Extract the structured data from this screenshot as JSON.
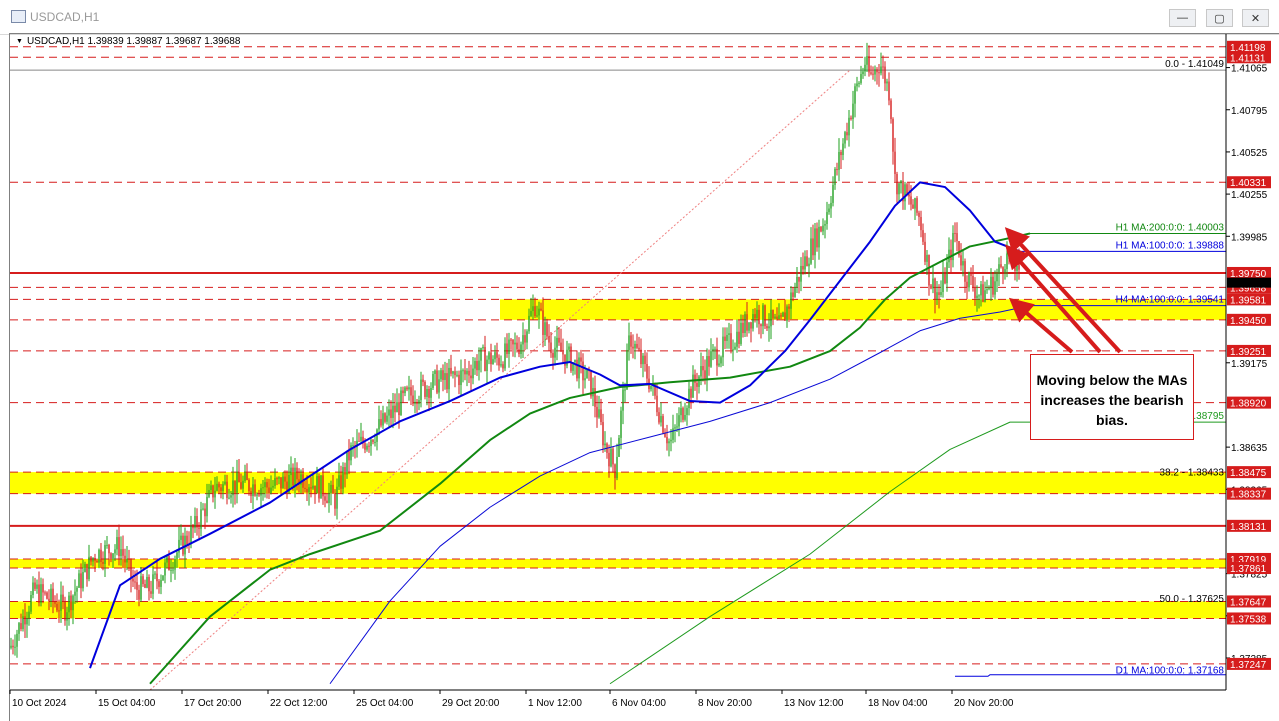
{
  "window": {
    "title": "USDCAD,H1",
    "minimize_glyph": "—",
    "maximize_glyph": "▢",
    "close_glyph": "✕"
  },
  "chart_header": {
    "symbol_info": "USDCAD,H1  1.39839 1.39887 1.39687 1.39688"
  },
  "callout": {
    "text": "Moving below the MAs increases the bearish bias."
  },
  "colors": {
    "hline": "#d61c1c",
    "zone": "#ffff00",
    "ma200": "#118811",
    "ma100": "#0000dd",
    "h4ma": "#0a0ad6",
    "d1ma": "#1f9a1f",
    "bull": "#1fa01f",
    "bear": "#d61c1c",
    "fib_line": "#ef8080"
  },
  "chart_data": {
    "type": "candlestick",
    "symbol": "USDCAD",
    "timeframe": "H1",
    "ylim": [
      1.3708,
      1.4128
    ],
    "x_labels": [
      "10 Oct 2024",
      "15 Oct 04:00",
      "17 Oct 20:00",
      "22 Oct 12:00",
      "25 Oct 04:00",
      "29 Oct 20:00",
      "1 Nov 12:00",
      "6 Nov 04:00",
      "8 Nov 20:00",
      "13 Nov 12:00",
      "18 Nov 04:00",
      "20 Nov 20:00"
    ],
    "price_ticks": [
      "1.41065",
      "1.40795",
      "1.40525",
      "1.40255",
      "1.39985",
      "1.39175",
      "1.38635",
      "1.38365",
      "1.37825",
      "1.37555",
      "1.37285"
    ],
    "price_tags": [
      {
        "value": 1.41198,
        "label": "1.41198",
        "style": "dash"
      },
      {
        "value": 1.41131,
        "label": "1.41131",
        "style": "dash"
      },
      {
        "value": 1.40331,
        "label": "1.40331",
        "style": "dash"
      },
      {
        "value": 1.3975,
        "label": "1.39750",
        "style": "solid"
      },
      {
        "value": 1.39658,
        "label": "1.39658",
        "style": "dash"
      },
      {
        "value": 1.39581,
        "label": "1.39581",
        "style": "dash"
      },
      {
        "value": 1.3945,
        "label": "1.39450",
        "style": "dash"
      },
      {
        "value": 1.39251,
        "label": "1.39251",
        "style": "dash"
      },
      {
        "value": 1.3892,
        "label": "1.38920",
        "style": "dash"
      },
      {
        "value": 1.38475,
        "label": "1.38475",
        "style": "dash"
      },
      {
        "value": 1.38337,
        "label": "1.38337",
        "style": "dash"
      },
      {
        "value": 1.38131,
        "label": "1.38131",
        "style": "solid"
      },
      {
        "value": 1.37919,
        "label": "1.37919",
        "style": "dash"
      },
      {
        "value": 1.37861,
        "label": "1.37861",
        "style": "dash"
      },
      {
        "value": 1.37647,
        "label": "1.37647",
        "style": "dash"
      },
      {
        "value": 1.37538,
        "label": "1.37538",
        "style": "dash"
      },
      {
        "value": 1.37247,
        "label": "1.37247",
        "style": "dash"
      }
    ],
    "current_price": 1.39688,
    "zones": [
      {
        "top": 1.39581,
        "bottom": 1.3945,
        "start": "29 Oct 20:00"
      },
      {
        "top": 1.38475,
        "bottom": 1.38337
      },
      {
        "top": 1.37919,
        "bottom": 1.37861
      },
      {
        "top": 1.37647,
        "bottom": 1.37538
      }
    ],
    "annotations": [
      {
        "text": "0.0 - 1.41049",
        "value": 1.41049
      },
      {
        "text": "H1 MA:200:0:0: 1.40003",
        "value": 1.40003
      },
      {
        "text": "H1 MA:100:0:0: 1.39888",
        "value": 1.39888
      },
      {
        "text": "H4 MA:100:0:0: 1.39541",
        "value": 1.39541
      },
      {
        "text": "38.2 - 1.38433",
        "value": 1.38433
      },
      {
        "text": "1.38795",
        "value": 1.38795
      },
      {
        "text": "50.0 - 1.37625",
        "value": 1.37625
      },
      {
        "text": "D1 MA:100:0:0: 1.37168",
        "value": 1.37168
      }
    ],
    "series": [
      {
        "name": "H1 MA:200",
        "color": "#118811",
        "last": 1.40003
      },
      {
        "name": "H1 MA:100",
        "color": "#0000dd",
        "last": 1.39888
      },
      {
        "name": "H4 MA:100",
        "color": "#0a0ad6",
        "last": 1.39541
      },
      {
        "name": "D1 MA:100",
        "color": "#1f9a1f",
        "last": 1.37168
      }
    ],
    "close_path": [
      [
        0,
        1.3735
      ],
      [
        25,
        1.3772
      ],
      [
        55,
        1.376
      ],
      [
        85,
        1.3795
      ],
      [
        110,
        1.38
      ],
      [
        125,
        1.3773
      ],
      [
        140,
        1.3773
      ],
      [
        160,
        1.379
      ],
      [
        185,
        1.3812
      ],
      [
        205,
        1.3838
      ],
      [
        230,
        1.384
      ],
      [
        260,
        1.3838
      ],
      [
        290,
        1.3845
      ],
      [
        310,
        1.3838
      ],
      [
        325,
        1.383
      ],
      [
        340,
        1.386
      ],
      [
        360,
        1.387
      ],
      [
        375,
        1.388
      ],
      [
        395,
        1.3895
      ],
      [
        425,
        1.3905
      ],
      [
        455,
        1.391
      ],
      [
        470,
        1.392
      ],
      [
        490,
        1.392
      ],
      [
        510,
        1.393
      ],
      [
        525,
        1.3955
      ],
      [
        540,
        1.393
      ],
      [
        560,
        1.392
      ],
      [
        580,
        1.3905
      ],
      [
        595,
        1.3865
      ],
      [
        605,
        1.385
      ],
      [
        620,
        1.3935
      ],
      [
        640,
        1.3905
      ],
      [
        660,
        1.3865
      ],
      [
        680,
        1.39
      ],
      [
        700,
        1.392
      ],
      [
        720,
        1.393
      ],
      [
        745,
        1.395
      ],
      [
        770,
        1.394
      ],
      [
        790,
        1.3975
      ],
      [
        800,
        1.399
      ],
      [
        815,
        1.401
      ],
      [
        830,
        1.405
      ],
      [
        845,
        1.409
      ],
      [
        855,
        1.411
      ],
      [
        860,
        1.41
      ],
      [
        870,
        1.411
      ],
      [
        880,
        1.409
      ],
      [
        885,
        1.4035
      ],
      [
        895,
        1.4025
      ],
      [
        910,
        1.401
      ],
      [
        920,
        1.397
      ],
      [
        930,
        1.396
      ],
      [
        945,
        1.4
      ],
      [
        955,
        1.3975
      ],
      [
        970,
        1.396
      ],
      [
        985,
        1.397
      ],
      [
        995,
        1.3985
      ],
      [
        1005,
        1.398
      ],
      [
        1010,
        1.3969
      ]
    ],
    "ma200_path": [
      [
        140,
        1.3712
      ],
      [
        200,
        1.3755
      ],
      [
        260,
        1.3785
      ],
      [
        300,
        1.3795
      ],
      [
        370,
        1.381
      ],
      [
        430,
        1.384
      ],
      [
        480,
        1.3868
      ],
      [
        520,
        1.3885
      ],
      [
        560,
        1.3895
      ],
      [
        610,
        1.3902
      ],
      [
        660,
        1.3905
      ],
      [
        720,
        1.3908
      ],
      [
        780,
        1.3915
      ],
      [
        820,
        1.3925
      ],
      [
        850,
        1.394
      ],
      [
        875,
        1.3958
      ],
      [
        900,
        1.3972
      ],
      [
        930,
        1.3982
      ],
      [
        960,
        1.3992
      ],
      [
        990,
        1.3996
      ],
      [
        1020,
        1.40003
      ]
    ],
    "ma100_path": [
      [
        80,
        1.3722
      ],
      [
        110,
        1.3775
      ],
      [
        150,
        1.3792
      ],
      [
        200,
        1.3808
      ],
      [
        260,
        1.3828
      ],
      [
        300,
        1.3845
      ],
      [
        340,
        1.3862
      ],
      [
        390,
        1.388
      ],
      [
        440,
        1.3893
      ],
      [
        490,
        1.3908
      ],
      [
        530,
        1.3915
      ],
      [
        560,
        1.3918
      ],
      [
        590,
        1.391
      ],
      [
        610,
        1.3903
      ],
      [
        640,
        1.3904
      ],
      [
        680,
        1.3893
      ],
      [
        710,
        1.3892
      ],
      [
        740,
        1.3903
      ],
      [
        775,
        1.3925
      ],
      [
        800,
        1.3945
      ],
      [
        830,
        1.397
      ],
      [
        860,
        1.3995
      ],
      [
        885,
        1.4018
      ],
      [
        910,
        1.4033
      ],
      [
        935,
        1.403
      ],
      [
        960,
        1.4015
      ],
      [
        985,
        1.3995
      ],
      [
        1010,
        1.39888
      ]
    ],
    "h4ma_path": [
      [
        320,
        1.3712
      ],
      [
        380,
        1.3765
      ],
      [
        430,
        1.38
      ],
      [
        480,
        1.3825
      ],
      [
        530,
        1.3845
      ],
      [
        580,
        1.386
      ],
      [
        640,
        1.387
      ],
      [
        700,
        1.388
      ],
      [
        760,
        1.3892
      ],
      [
        820,
        1.3907
      ],
      [
        870,
        1.3924
      ],
      [
        910,
        1.3938
      ],
      [
        950,
        1.3946
      ],
      [
        990,
        1.395
      ],
      [
        1020,
        1.39541
      ]
    ],
    "d1ma_path": [
      [
        600,
        1.3712
      ],
      [
        700,
        1.3755
      ],
      [
        800,
        1.3795
      ],
      [
        880,
        1.3835
      ],
      [
        940,
        1.3862
      ],
      [
        1000,
        1.38795
      ],
      [
        1030,
        1.38795
      ]
    ]
  }
}
